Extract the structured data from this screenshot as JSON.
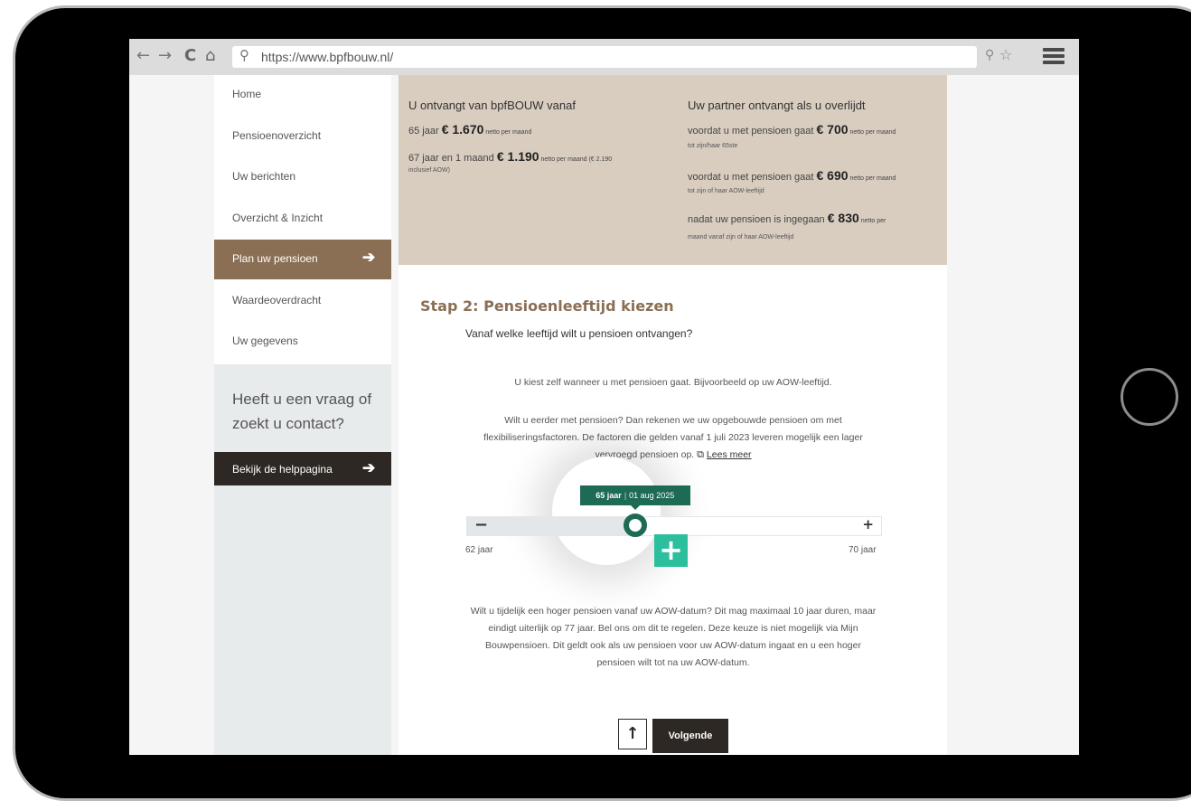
{
  "browser": {
    "back": "←",
    "forward": "→",
    "reload": "C",
    "home": "⌂",
    "url": "https://www.bpfbouw.nl/"
  },
  "sidebar": {
    "items": [
      {
        "label": "Home"
      },
      {
        "label": "Pensioenoverzicht"
      },
      {
        "label": "Uw berichten"
      },
      {
        "label": "Overzicht & Inzicht"
      },
      {
        "label": "Plan uw pensioen",
        "active": true
      },
      {
        "label": "Waardeoverdracht"
      },
      {
        "label": "Uw gegevens"
      }
    ],
    "help_question": "Heeft u een vraag of zoekt u contact?",
    "help_button": "Bekijk de helppagina",
    "arrow": "➔"
  },
  "summary": {
    "left_heading": "U ontvangt van bpfBOUW vanaf",
    "left_line1_pre": "65 jaar ",
    "left_line1_amount": "€ 1.670",
    "left_line1_post": " netto per maand",
    "left_line2_pre": "67 jaar en 1 maand ",
    "left_line2_amount": "€ 1.190",
    "left_line2_post": " netto per maand (€ 2.190",
    "left_line2_sub": "inclusief AOW)",
    "right_heading": "Uw partner ontvangt als u overlijdt",
    "right_line1_pre": "voordat u met pensioen gaat ",
    "right_line1_amount": "€ 700",
    "right_line1_post": " netto per maand",
    "right_line1_sub": "tot zijn/haar 65ste",
    "right_line2_pre": "voordat u met pensioen gaat ",
    "right_line2_amount": "€ 690",
    "right_line2_post": " netto per maand",
    "right_line2_sub": "tot zijn of haar AOW-leeftijd",
    "right_line3_pre": "nadat uw pensioen is ingegaan ",
    "right_line3_amount": "€ 830",
    "right_line3_post": " netto per",
    "right_line3_sub": "maand vanaf zijn of haar AOW-leeftijd"
  },
  "step": {
    "title": "Stap 2: Pensioenleeftijd kiezen",
    "question": "Vanaf welke leeftijd wilt u pensioen ontvangen?",
    "para1": "U kiest zelf wanneer u met pensioen gaat. Bijvoorbeeld op uw AOW-leeftijd.",
    "para2": "Wilt u eerder met pensioen? Dan rekenen we uw opgebouwde pensioen om met flexibiliseringsfactoren. De factoren die gelden vanaf 1 juli 2023 leveren mogelijk een lager vervroegd pensioen op.",
    "para2_link": "Lees meer",
    "para3": "Wilt u tijdelijk een hoger pensioen vanaf uw AOW-datum? Dit mag maximaal 10 jaar duren, maar eindigt uiterlijk op 77 jaar. Bel ons om dit te regelen. Deze keuze is niet mogelijk via Mijn Bouwpensioen. Dit geldt ook als uw pensioen voor uw AOW-datum ingaat en u een hoger pensioen wilt tot na uw AOW-datum."
  },
  "slider": {
    "min_label": "62 jaar",
    "max_label": "70 jaar",
    "min": 62,
    "max": 70,
    "value": 65,
    "tooltip_age": "65 jaar",
    "tooltip_date": "01 aug 2025",
    "minus": "−",
    "plus": "+",
    "badge": "+",
    "accent": "#1d6a55",
    "badge_color": "#2bbf9d"
  },
  "actions": {
    "up": "↑",
    "next": "Volgende"
  },
  "colors": {
    "brand_brown": "#8b6f55",
    "dark": "#2d2823",
    "summary_bg": "#d9cdc0"
  }
}
